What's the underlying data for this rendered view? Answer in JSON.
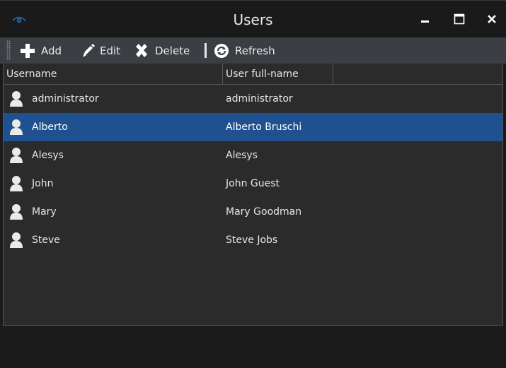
{
  "window": {
    "title": "Users"
  },
  "toolbar": {
    "add_label": "Add",
    "edit_label": "Edit",
    "delete_label": "Delete",
    "refresh_label": "Refresh"
  },
  "table": {
    "columns": [
      "Username",
      "User full-name"
    ],
    "rows": [
      {
        "username": "administrator",
        "fullname": "administrator",
        "selected": false
      },
      {
        "username": "Alberto",
        "fullname": "Alberto Bruschi",
        "selected": true
      },
      {
        "username": "Alesys",
        "fullname": "Alesys",
        "selected": false
      },
      {
        "username": "John",
        "fullname": "John Guest",
        "selected": false
      },
      {
        "username": "Mary",
        "fullname": "Mary Goodman",
        "selected": false
      },
      {
        "username": "Steve",
        "fullname": "Steve Jobs",
        "selected": false
      }
    ]
  },
  "colors": {
    "selection": "#1f5190",
    "toolbar_bg": "#3b3e42",
    "window_bg": "#1b1b1b",
    "table_bg": "#2b2b2b"
  },
  "icons": [
    "app-eye-icon",
    "minimize-icon",
    "maximize-icon",
    "close-icon",
    "plus-icon",
    "pencil-icon",
    "x-delete-icon",
    "refresh-icon",
    "user-icon"
  ]
}
